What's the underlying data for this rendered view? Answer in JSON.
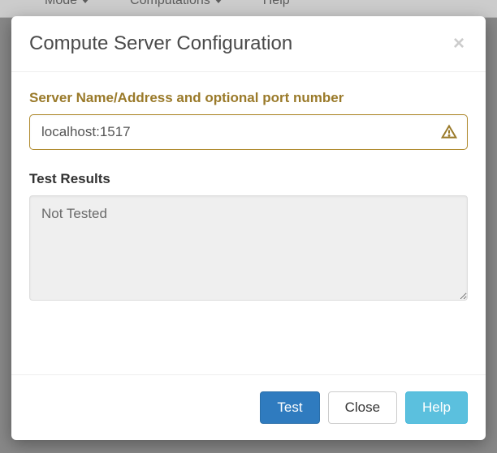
{
  "background_menu": {
    "items": [
      "Mode",
      "Computations",
      "Help"
    ]
  },
  "modal": {
    "title": "Compute Server Configuration",
    "server_field": {
      "label": "Server Name/Address and optional port number",
      "value": "localhost:1517",
      "warning_icon": "warning-triangle-icon"
    },
    "results": {
      "label": "Test Results",
      "value": "Not Tested"
    },
    "buttons": {
      "test": "Test",
      "close": "Close",
      "help": "Help"
    }
  }
}
